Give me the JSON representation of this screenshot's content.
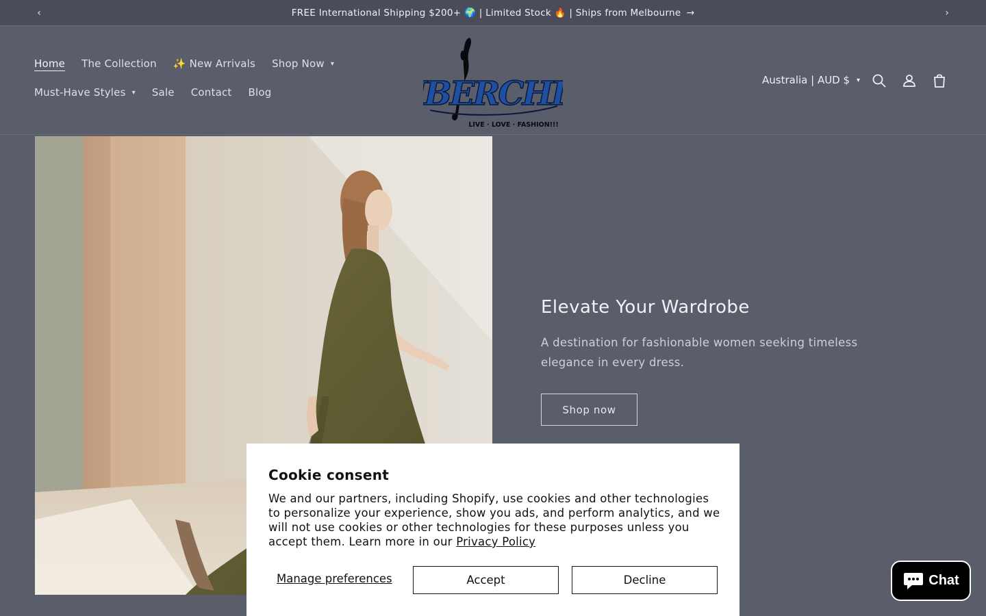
{
  "announcement": {
    "text": "FREE International Shipping $200+ 🌍 | Limited Stock 🔥 | Ships from Melbourne",
    "arrow": "→",
    "prev_icon": "‹",
    "next_icon": "›"
  },
  "nav": {
    "row1": [
      {
        "label": "Home",
        "active": true
      },
      {
        "label": "The Collection"
      },
      {
        "label": "✨ New Arrivals"
      },
      {
        "label": "Shop Now",
        "dropdown": true
      }
    ],
    "row2": [
      {
        "label": "Must-Have Styles",
        "dropdown": true
      },
      {
        "label": "Sale"
      },
      {
        "label": "Contact"
      },
      {
        "label": "Blog"
      }
    ]
  },
  "logo": {
    "brand": "UBERCHIC",
    "tagline": "LIVE · LOVE · FASHION!!!"
  },
  "header_tools": {
    "locale": "Australia | AUD $",
    "icons": [
      "search-icon",
      "account-icon",
      "cart-icon"
    ]
  },
  "hero": {
    "title": "Elevate Your Wardrobe",
    "subtitle": "A destination for fashionable women seeking timeless elegance in every dress.",
    "button": "Shop now"
  },
  "cookie": {
    "title": "Cookie consent",
    "body": "We and our partners, including Shopify, use cookies and other technologies to personalize your experience, show you ads, and perform analytics, and we will not use cookies or other technologies for these purposes unless you accept them. Learn more in our",
    "link": "Privacy Policy",
    "manage": "Manage preferences",
    "accept": "Accept",
    "decline": "Decline"
  },
  "chat": {
    "label": "Chat"
  },
  "colors": {
    "page_bg": "#5a5d6a",
    "announcement_bg": "#4a4d59",
    "logo_blue": "#1f4fa0",
    "chat_bg": "#000000"
  }
}
